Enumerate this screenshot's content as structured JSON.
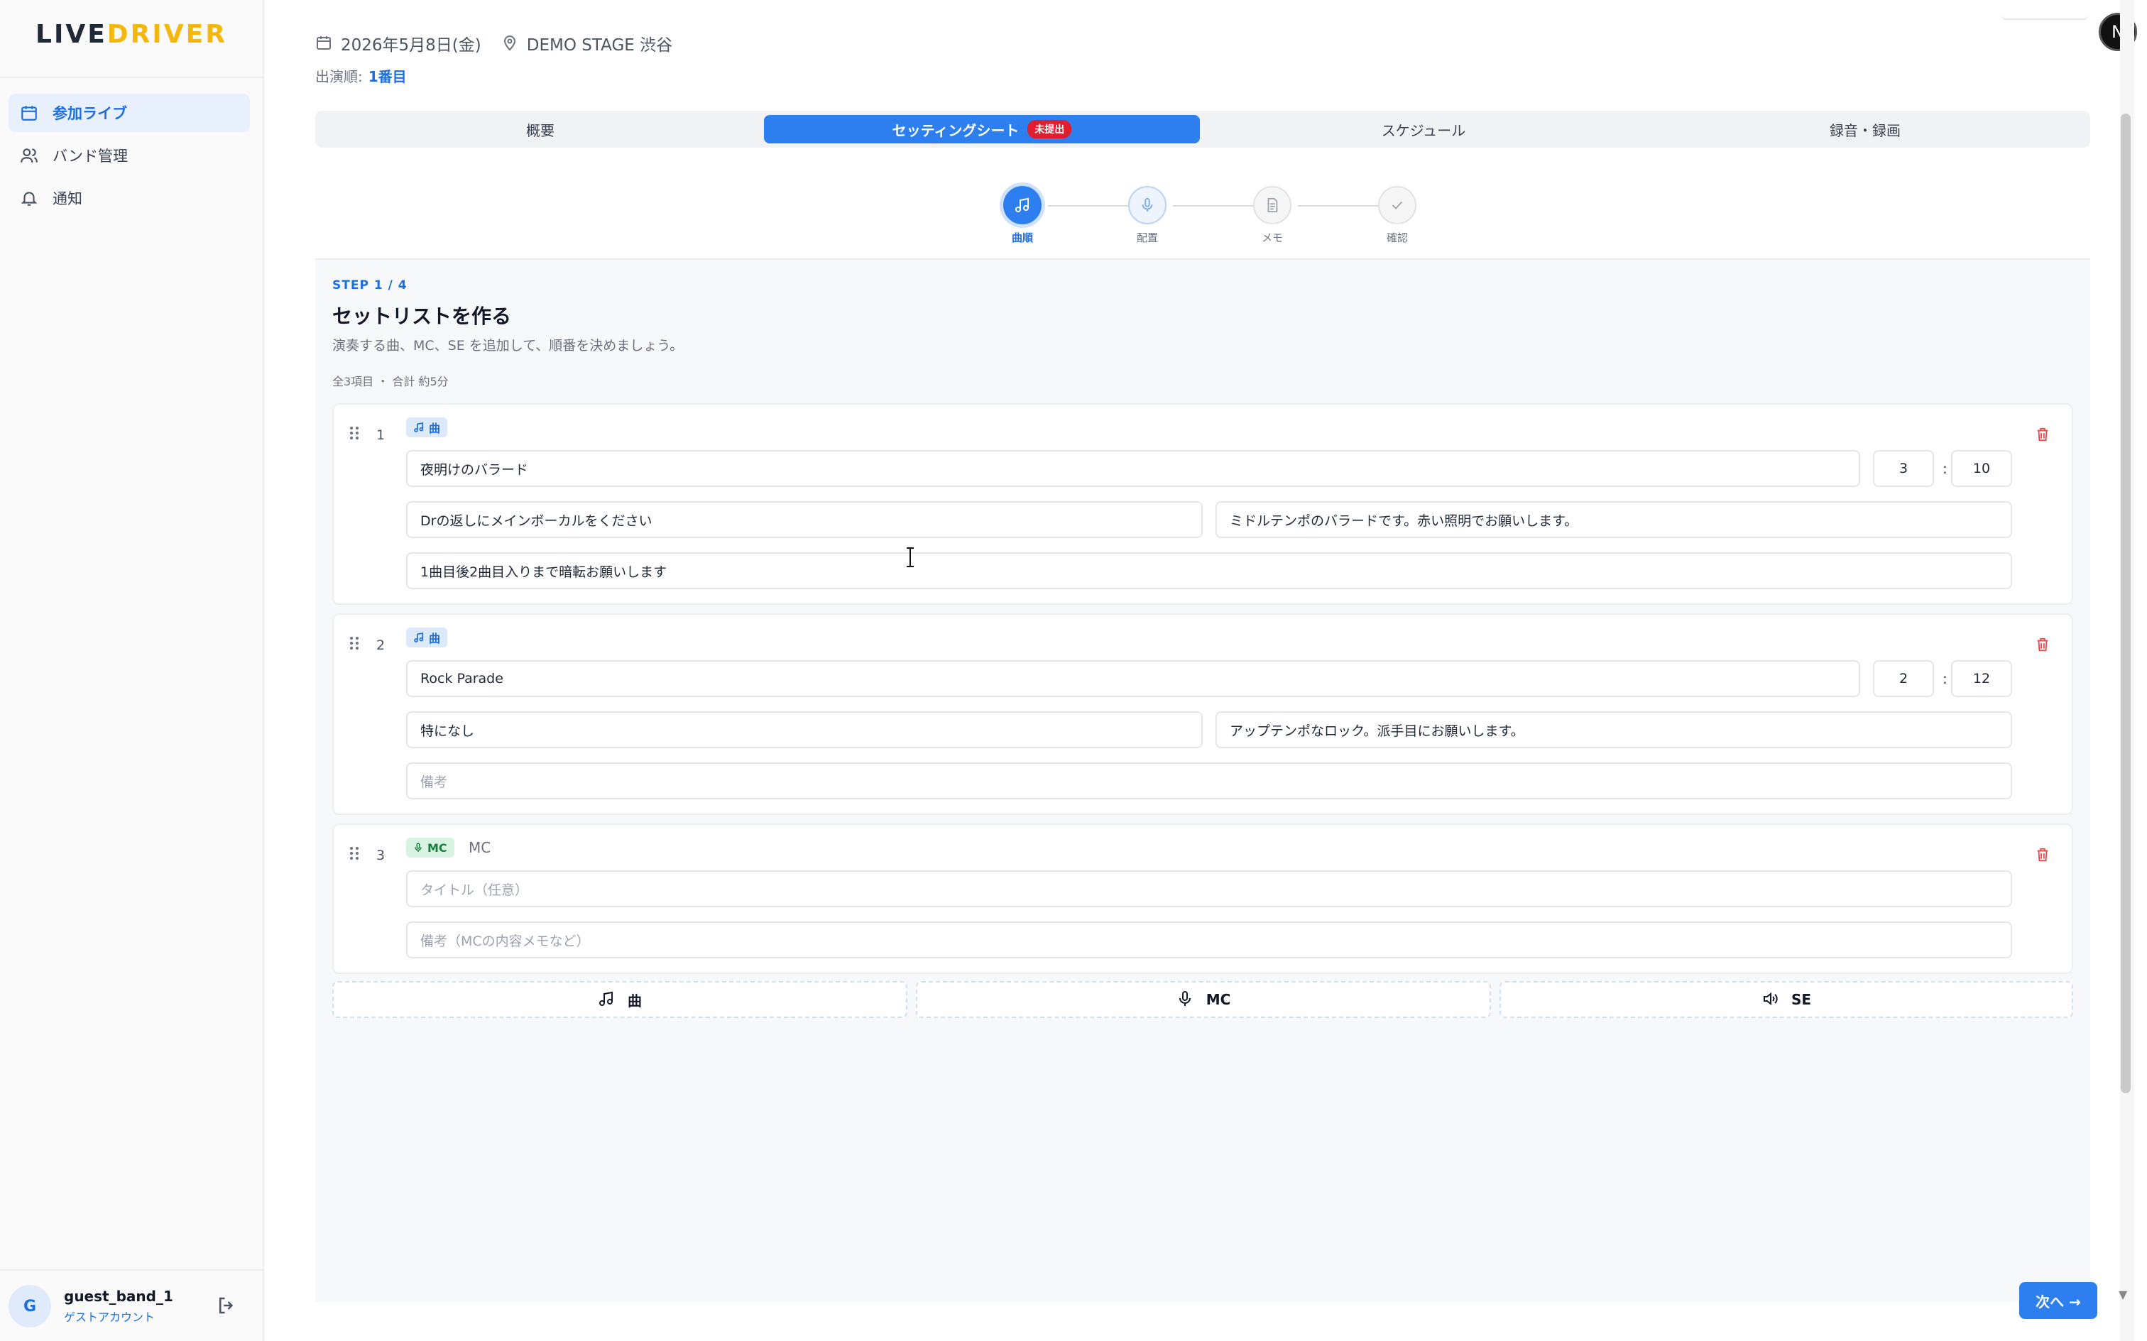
{
  "sidebar": {
    "logo_a": "LIVE",
    "logo_b": "DRIVER",
    "items": [
      {
        "label": "参加ライブ",
        "icon": "calendar-icon",
        "active": true
      },
      {
        "label": "バンド管理",
        "icon": "users-icon",
        "active": false
      },
      {
        "label": "通知",
        "icon": "bell-icon",
        "active": false
      }
    ],
    "user": {
      "initial": "G",
      "name": "guest_band_1",
      "role": "ゲストアカウント"
    }
  },
  "header": {
    "date": "2026年5月8日(金)",
    "venue": "DEMO STAGE 渋谷",
    "order_label": "出演順:",
    "order_value": "1番目",
    "avatar_initial": "N"
  },
  "tabs": [
    {
      "label": "概要",
      "active": false
    },
    {
      "label": "セッティングシート",
      "active": true,
      "badge": "未提出"
    },
    {
      "label": "スケジュール",
      "active": false
    },
    {
      "label": "録音・録画",
      "active": false
    }
  ],
  "stepper": [
    {
      "label": "曲順",
      "icon": "music-note-icon",
      "state": "current"
    },
    {
      "label": "配置",
      "icon": "mic-icon",
      "state": "next"
    },
    {
      "label": "メモ",
      "icon": "document-icon",
      "state": "pending"
    },
    {
      "label": "確認",
      "icon": "check-icon",
      "state": "pending"
    }
  ],
  "panel": {
    "step_tag": "STEP 1 / 4",
    "title": "セットリストを作る",
    "description": "演奏する曲、MC、SE を追加して、順番を決めましょう。",
    "summary": "全3項目 ・ 合計 約5分"
  },
  "setlist": [
    {
      "num": "1",
      "type_label": "曲",
      "title": "夜明けのバラード",
      "minutes": "3",
      "seconds": "10",
      "monitor": "Drの返しにメインボーカルをください",
      "lighting": "ミドルテンポのバラードです。赤い照明でお願いします。",
      "note": "1曲目後2曲目入りまで暗転お願いします"
    },
    {
      "num": "2",
      "type_label": "曲",
      "title": "Rock Parade",
      "minutes": "2",
      "seconds": "12",
      "monitor": "特になし",
      "lighting": "アップテンポなロック。派手目にお願いします。",
      "note_placeholder": "備考"
    },
    {
      "num": "3",
      "type_label": "MC",
      "type_extra": "MC",
      "title_placeholder": "タイトル（任意）",
      "note_placeholder": "備考（MCの内容メモなど）"
    }
  ],
  "add_buttons": [
    {
      "label": "曲",
      "icon": "music-note-icon"
    },
    {
      "label": "MC",
      "icon": "mic-icon"
    },
    {
      "label": "SE",
      "icon": "speaker-icon"
    }
  ],
  "next_button": "次へ →",
  "colors": {
    "accent": "#2d7ff0",
    "badge_red": "#e11d2e",
    "logo_yellow": "#f5b70b",
    "mc_green": "#15803d"
  }
}
